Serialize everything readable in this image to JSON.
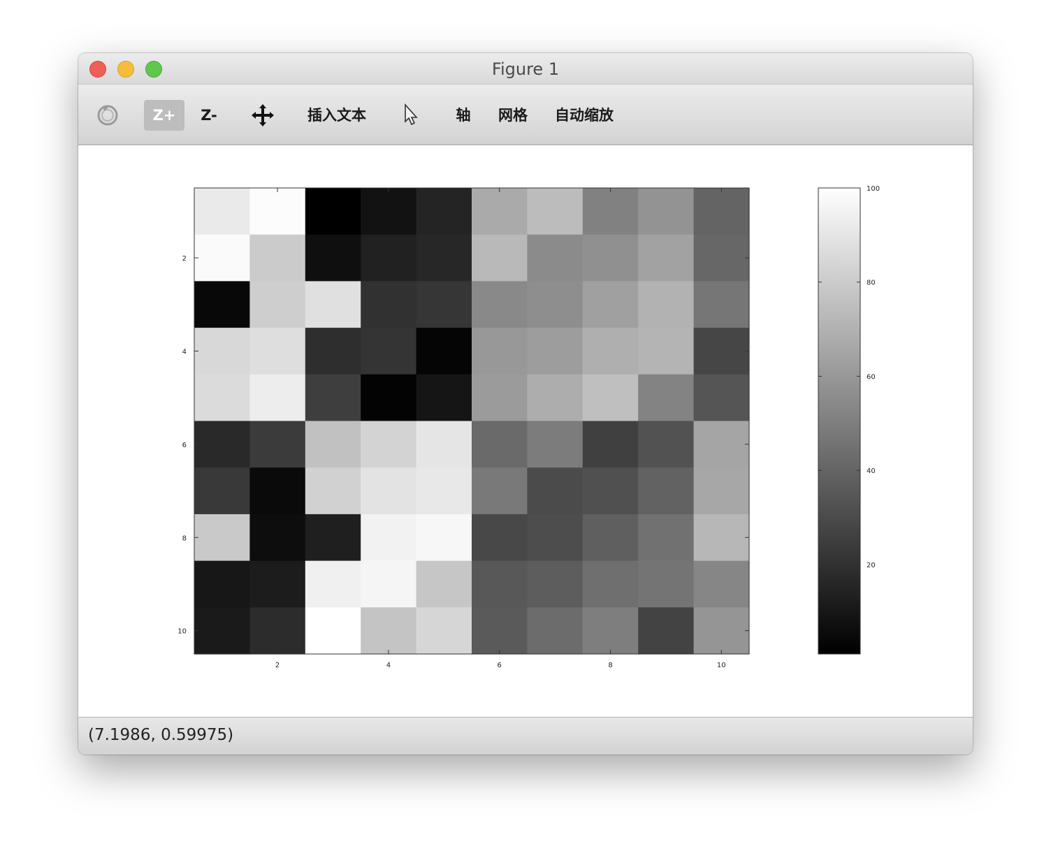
{
  "window": {
    "title": "Figure 1"
  },
  "toolbar": {
    "rotate_icon": "rotate-icon",
    "zoom_in_label": "Z+",
    "zoom_out_label": "Z-",
    "pan_icon": "pan-icon",
    "insert_text_label": "插入文本",
    "select_icon": "pointer-icon",
    "axis_label": "轴",
    "grid_label": "网格",
    "autoscale_label": "自动缩放"
  },
  "status": {
    "coordinates": "(7.1986, 0.59975)"
  },
  "chart_data": {
    "type": "heatmap",
    "colormap": "gray",
    "x_ticks": [
      "2",
      "4",
      "6",
      "8",
      "10"
    ],
    "y_ticks": [
      "2",
      "4",
      "6",
      "8",
      "10"
    ],
    "xlim": [
      0.5,
      10.5
    ],
    "ylim": [
      0.5,
      10.5
    ],
    "y_direction": "reversed",
    "colorbar": {
      "range": [
        1,
        100
      ],
      "ticks": [
        "20",
        "40",
        "60",
        "80",
        "100"
      ]
    },
    "values": [
      [
        92,
        99,
        1,
        8,
        15,
        67,
        74,
        51,
        58,
        40
      ],
      [
        98,
        80,
        7,
        14,
        16,
        73,
        55,
        57,
        64,
        41
      ],
      [
        4,
        81,
        88,
        20,
        22,
        54,
        56,
        63,
        70,
        47
      ],
      [
        85,
        87,
        19,
        21,
        3,
        60,
        62,
        69,
        71,
        28
      ],
      [
        86,
        93,
        25,
        2,
        9,
        61,
        68,
        75,
        52,
        34
      ],
      [
        17,
        24,
        76,
        83,
        90,
        42,
        49,
        26,
        33,
        65
      ],
      [
        23,
        5,
        82,
        89,
        91,
        48,
        30,
        32,
        39,
        66
      ],
      [
        79,
        6,
        13,
        95,
        97,
        29,
        31,
        38,
        45,
        72
      ],
      [
        10,
        12,
        94,
        96,
        78,
        35,
        37,
        44,
        46,
        53
      ],
      [
        11,
        18,
        100,
        77,
        84,
        36,
        43,
        50,
        27,
        59
      ]
    ]
  }
}
